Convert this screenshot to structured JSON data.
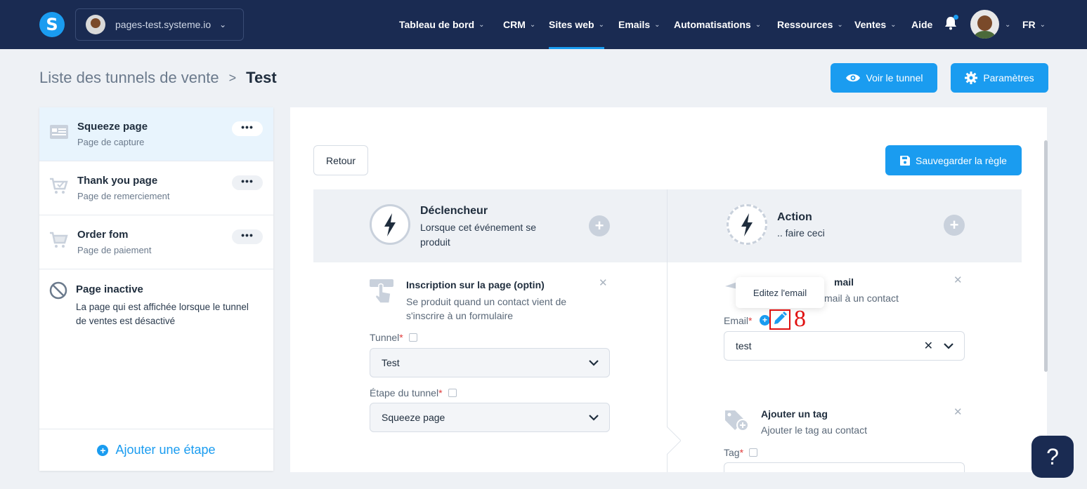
{
  "nav": {
    "logo": "S",
    "site_name": "pages-test.systeme.io",
    "menu": [
      {
        "label": "Tableau de bord"
      },
      {
        "label": "CRM"
      },
      {
        "label": "Sites web"
      },
      {
        "label": "Emails"
      },
      {
        "label": "Automatisations"
      },
      {
        "label": "Ressources"
      },
      {
        "label": "Ventes"
      },
      {
        "label": "Aide"
      }
    ],
    "language": "FR"
  },
  "breadcrumb": {
    "parent": "Liste des tunnels de vente",
    "separator": ">",
    "current": "Test"
  },
  "header_buttons": {
    "view_funnel": "Voir le tunnel",
    "settings": "Paramètres"
  },
  "sidebar": {
    "steps": [
      {
        "title": "Squeeze page",
        "subtitle": "Page de capture",
        "more": "•••"
      },
      {
        "title": "Thank you page",
        "subtitle": "Page de remerciement",
        "more": "•••"
      },
      {
        "title": "Order fom",
        "subtitle": "Page de paiement",
        "more": "•••"
      }
    ],
    "inactive": {
      "title": "Page inactive",
      "description": "La page qui est affichée lorsque le tunnel de ventes est désactivé"
    },
    "add_step": "Ajouter une étape"
  },
  "rule": {
    "back": "Retour",
    "save": "Sauvegarder la règle",
    "trigger_header": {
      "title": "Déclencheur",
      "subtitle": "Lorsque cet événement se produit"
    },
    "action_header": {
      "title": "Action",
      "subtitle": ".. faire ceci"
    },
    "trigger": {
      "title": "Inscription sur la page (optin)",
      "description": "Se produit quand un contact vient de s'inscrire à un formulaire",
      "tunnel_label": "Tunnel",
      "tunnel_value": "Test",
      "step_label": "Étape du tunnel",
      "step_value": "Squeeze page"
    },
    "action_email": {
      "title_partial": "mail",
      "description_partial": "mail à un contact",
      "email_label": "Email",
      "email_value": "test",
      "tooltip": "Editez l'email"
    },
    "action_tag": {
      "title": "Ajouter un tag",
      "description": "Ajouter le tag au contact",
      "tag_label": "Tag"
    }
  },
  "annotation": {
    "number": "8"
  },
  "help": "?",
  "colors": {
    "nav_bg": "#1a2b52",
    "accent": "#1a9cf0",
    "annotation": "#e01010"
  }
}
